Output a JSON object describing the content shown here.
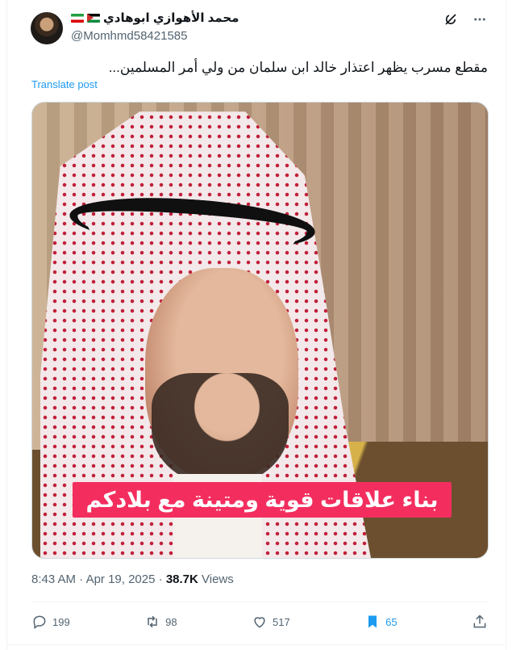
{
  "author": {
    "display_name": "محمد الأهوازي ابوهادي",
    "flags": [
      "palestine-flag",
      "iran-flag"
    ],
    "handle": "@Momhmd58421585"
  },
  "post": {
    "text": "مقطع مسرب يظهر اعتذار خالد ابن سلمان من ولي أمر المسلمين...",
    "translate_label": "Translate post",
    "video_caption": "بناء علاقات قوية ومتينة مع بلادكم",
    "time": "8:43 AM",
    "date": "Apr 19, 2025",
    "views_count": "38.7K",
    "views_label": "Views",
    "dot": "·"
  },
  "actions": {
    "replies": "199",
    "reposts": "98",
    "likes": "517",
    "bookmarks": "65"
  },
  "colors": {
    "accent": "#1d9bf0",
    "caption_bg": "#f32e5e",
    "muted_text": "#536471"
  }
}
